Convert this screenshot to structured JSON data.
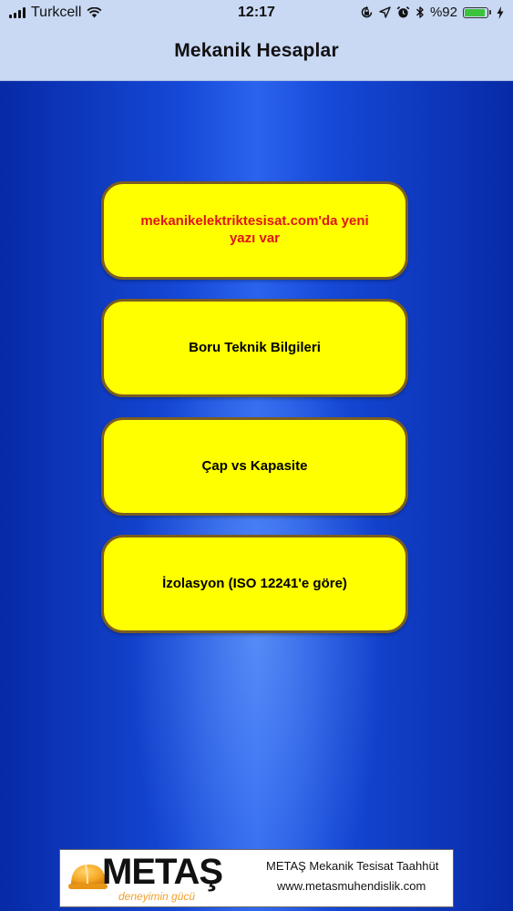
{
  "status_bar": {
    "carrier": "Turkcell",
    "time": "12:17",
    "battery_text": "%92",
    "battery_level": 0.92,
    "battery_color": "#3cc33c",
    "icons": [
      "signal-icon",
      "wifi-icon",
      "orientation-lock-icon",
      "location-arrow-icon",
      "alarm-icon",
      "bluetooth-icon",
      "battery-icon",
      "charging-bolt-icon"
    ]
  },
  "navbar": {
    "title": "Mekanik Hesaplar"
  },
  "menu": {
    "items": [
      {
        "label": "mekanikelektriktesisat.com'da yeni yazı var",
        "color": "#e0151b"
      },
      {
        "label": "Boru Teknik Bilgileri",
        "color": "#000000"
      },
      {
        "label": "Çap vs Kapasite",
        "color": "#000000"
      },
      {
        "label": "İzolasyon (ISO 12241'e göre)",
        "color": "#000000"
      }
    ],
    "button_color": "#ffff00",
    "border_color": "#7a5d22"
  },
  "banner": {
    "brand": "METAŞ",
    "slogan": "deneyimin gücü",
    "line1": "METAŞ Mekanik Tesisat Taahhüt",
    "line2": "www.metasmuhendislik.com",
    "accent_color": "#f0a02a"
  }
}
